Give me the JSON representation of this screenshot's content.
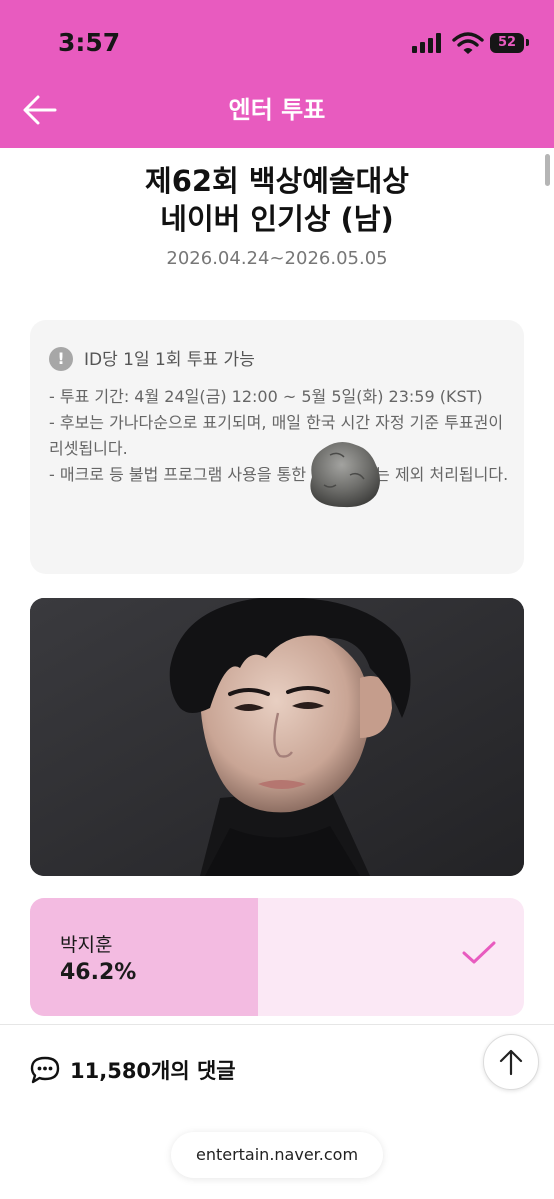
{
  "status_bar": {
    "time": "3:57",
    "battery_level": "52"
  },
  "header": {
    "title": "엔터 투표",
    "background_color": "#e85bbf"
  },
  "vote": {
    "title_line1": "제62회 백상예술대상",
    "title_line2": "네이버 인기상 (남)",
    "period": "2026.04.24~2026.05.05"
  },
  "notice": {
    "heading": "ID당 1일 1회 투표 가능",
    "lines": [
      "- 투표 기간: 4월 24일(금) 12:00 ~ 5월 5일(화) 23:59 (KST)",
      "- 후보는 가나다순으로 표기되며, 매일 한국 시간 자정 기준 투표권이 리셋됩니다.",
      "- 매크로 등 불법 프로그램 사용을 통한 투표 결과는 제외 처리됩니다."
    ]
  },
  "candidate": {
    "name": "박지훈",
    "percent_label": "46.2%",
    "percent_value": 46.2,
    "voted": true,
    "accent_color": "#e85bbf"
  },
  "comments": {
    "count_label": "11,580개의 댓글"
  },
  "browser": {
    "url": "entertain.naver.com"
  }
}
